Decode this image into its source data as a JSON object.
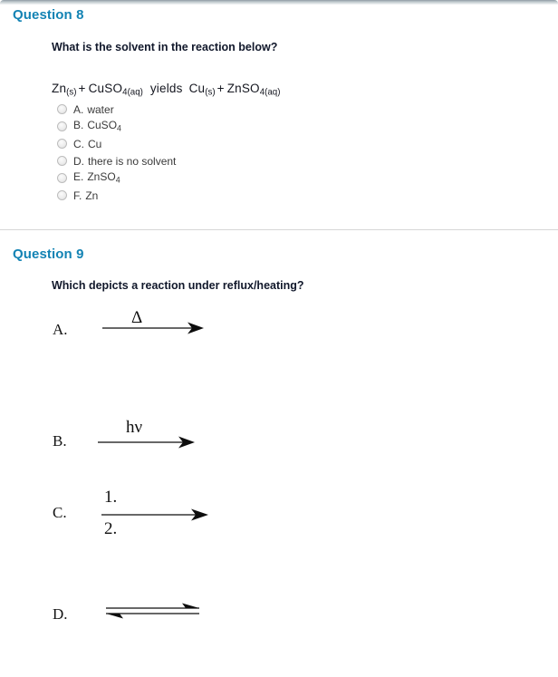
{
  "page": {
    "background_color": "#ffffff",
    "heading_color": "#1383b4",
    "text_color": "#11182b",
    "divider_color": "#d7d7d7"
  },
  "questions": [
    {
      "heading": "Question 8",
      "prompt": "What is the solvent in the reaction below?",
      "equation": {
        "reactant_1": "Zn",
        "reactant_1_state": "(s)",
        "plus_1": "+",
        "reactant_2": "CuSO",
        "reactant_2_num": "4",
        "reactant_2_state": "(aq)",
        "yields": "yields",
        "product_1": "Cu",
        "product_1_state": "(s)",
        "plus_2": "+",
        "product_2": "ZnSO",
        "product_2_num": "4",
        "product_2_state": "(aq)"
      },
      "options": [
        {
          "letter": "A.",
          "text": "water",
          "sub": "",
          "after": "",
          "selected": false
        },
        {
          "letter": "B.",
          "text": "CuSO",
          "sub": "4",
          "after": "",
          "selected": false
        },
        {
          "letter": "C.",
          "text": "Cu",
          "sub": "",
          "after": "",
          "selected": false
        },
        {
          "letter": "D.",
          "text": "there is no solvent",
          "sub": "",
          "after": "",
          "selected": false
        },
        {
          "letter": "E.",
          "text": "ZnSO",
          "sub": "4",
          "after": "",
          "selected": false
        },
        {
          "letter": "F.",
          "text": "Zn",
          "sub": "",
          "after": "",
          "selected": false
        }
      ]
    },
    {
      "heading": "Question 9",
      "prompt": "Which depicts a reaction under reflux/heating?",
      "choices": [
        {
          "letter": "A.",
          "above": "Δ",
          "below": "",
          "arrow_type": "single-right"
        },
        {
          "letter": "B.",
          "above": "hν",
          "below": "",
          "arrow_type": "single-right"
        },
        {
          "letter": "C.",
          "above": "1.",
          "below": "2.",
          "arrow_type": "single-right"
        },
        {
          "letter": "D.",
          "above": "",
          "below": "",
          "arrow_type": "equilibrium"
        }
      ]
    }
  ]
}
